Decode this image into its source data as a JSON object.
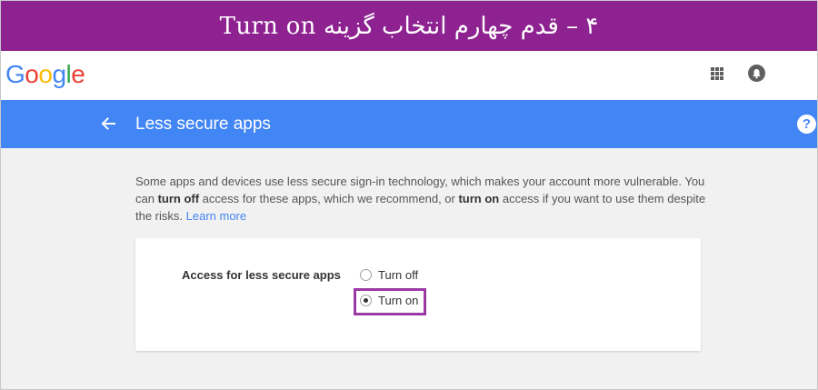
{
  "banner": {
    "text": "۴ – قدم چهارم انتخاب گزینه Turn on"
  },
  "header": {
    "logo_letters": [
      {
        "char": "G",
        "color": "#4285f4"
      },
      {
        "char": "o",
        "color": "#ea4335"
      },
      {
        "char": "o",
        "color": "#fbbc05"
      },
      {
        "char": "g",
        "color": "#4285f4"
      },
      {
        "char": "l",
        "color": "#34a853"
      },
      {
        "char": "e",
        "color": "#ea4335"
      }
    ],
    "apps_icon": "apps-grid-icon",
    "notifications_icon": "bell-icon"
  },
  "toolbar": {
    "back_icon": "back-arrow-icon",
    "title": "Less secure apps",
    "help_label": "?",
    "color": "#4285f4"
  },
  "main": {
    "description_parts": {
      "p1": "Some apps and devices use less secure sign-in technology, which makes your account more vulnerable. You can ",
      "b1": "turn off",
      "p2": " access for these apps, which we recommend, or ",
      "b2": "turn on",
      "p3": " access if you want to use them despite the risks. ",
      "link": "Learn more"
    },
    "setting": {
      "label": "Access for less secure apps",
      "options": [
        {
          "label": "Turn off",
          "selected": false
        },
        {
          "label": "Turn on",
          "selected": true
        }
      ]
    }
  },
  "colors": {
    "banner": "#8e2291",
    "highlight": "#9b3aa5",
    "link": "#4285f4"
  }
}
